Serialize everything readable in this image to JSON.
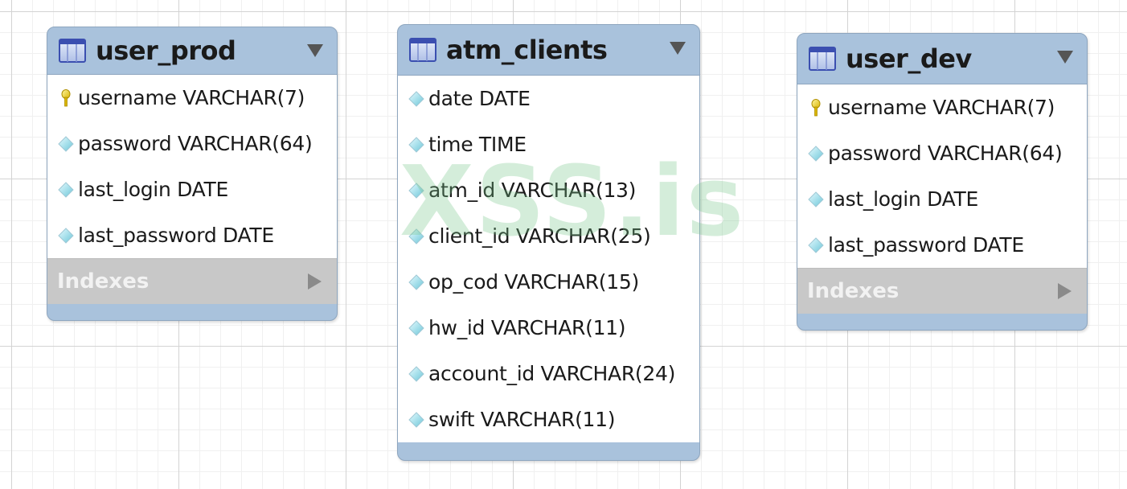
{
  "tables": [
    {
      "title": "user_prod",
      "columns": [
        {
          "text": "username VARCHAR(7)",
          "icon": "primary-key-icon"
        },
        {
          "text": "password VARCHAR(64)",
          "icon": "column-icon"
        },
        {
          "text": "last_login DATE",
          "icon": "column-icon"
        },
        {
          "text": "last_password DATE",
          "icon": "column-icon"
        }
      ],
      "indexes_label": "Indexes"
    },
    {
      "title": "atm_clients",
      "columns": [
        {
          "text": "date DATE",
          "icon": "column-icon"
        },
        {
          "text": "time TIME",
          "icon": "column-icon"
        },
        {
          "text": "atm_id VARCHAR(13)",
          "icon": "column-icon"
        },
        {
          "text": "client_id VARCHAR(25)",
          "icon": "column-icon"
        },
        {
          "text": "op_cod VARCHAR(15)",
          "icon": "column-icon"
        },
        {
          "text": "hw_id VARCHAR(11)",
          "icon": "column-icon"
        },
        {
          "text": "account_id VARCHAR(24)",
          "icon": "column-icon"
        },
        {
          "text": "swift VARCHAR(11)",
          "icon": "column-icon"
        }
      ]
    },
    {
      "title": "user_dev",
      "columns": [
        {
          "text": "username VARCHAR(7)",
          "icon": "primary-key-icon"
        },
        {
          "text": "password VARCHAR(64)",
          "icon": "column-icon"
        },
        {
          "text": "last_login DATE",
          "icon": "column-icon"
        },
        {
          "text": "last_password DATE",
          "icon": "column-icon"
        }
      ],
      "indexes_label": "Indexes"
    }
  ],
  "watermark": "XSS.is",
  "colors": {
    "header": "#a9c2dc",
    "indexes_bg": "#c8c8c8",
    "watermark": "#78c88c"
  }
}
